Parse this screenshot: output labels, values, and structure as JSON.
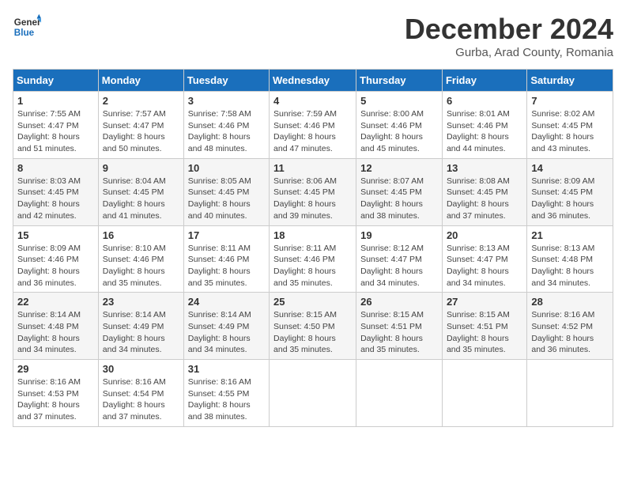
{
  "header": {
    "logo_general": "General",
    "logo_blue": "Blue",
    "month_title": "December 2024",
    "location": "Gurba, Arad County, Romania"
  },
  "days_of_week": [
    "Sunday",
    "Monday",
    "Tuesday",
    "Wednesday",
    "Thursday",
    "Friday",
    "Saturday"
  ],
  "weeks": [
    [
      {
        "day": "1",
        "sunrise": "Sunrise: 7:55 AM",
        "sunset": "Sunset: 4:47 PM",
        "daylight": "Daylight: 8 hours and 51 minutes."
      },
      {
        "day": "2",
        "sunrise": "Sunrise: 7:57 AM",
        "sunset": "Sunset: 4:47 PM",
        "daylight": "Daylight: 8 hours and 50 minutes."
      },
      {
        "day": "3",
        "sunrise": "Sunrise: 7:58 AM",
        "sunset": "Sunset: 4:46 PM",
        "daylight": "Daylight: 8 hours and 48 minutes."
      },
      {
        "day": "4",
        "sunrise": "Sunrise: 7:59 AM",
        "sunset": "Sunset: 4:46 PM",
        "daylight": "Daylight: 8 hours and 47 minutes."
      },
      {
        "day": "5",
        "sunrise": "Sunrise: 8:00 AM",
        "sunset": "Sunset: 4:46 PM",
        "daylight": "Daylight: 8 hours and 45 minutes."
      },
      {
        "day": "6",
        "sunrise": "Sunrise: 8:01 AM",
        "sunset": "Sunset: 4:46 PM",
        "daylight": "Daylight: 8 hours and 44 minutes."
      },
      {
        "day": "7",
        "sunrise": "Sunrise: 8:02 AM",
        "sunset": "Sunset: 4:45 PM",
        "daylight": "Daylight: 8 hours and 43 minutes."
      }
    ],
    [
      {
        "day": "8",
        "sunrise": "Sunrise: 8:03 AM",
        "sunset": "Sunset: 4:45 PM",
        "daylight": "Daylight: 8 hours and 42 minutes."
      },
      {
        "day": "9",
        "sunrise": "Sunrise: 8:04 AM",
        "sunset": "Sunset: 4:45 PM",
        "daylight": "Daylight: 8 hours and 41 minutes."
      },
      {
        "day": "10",
        "sunrise": "Sunrise: 8:05 AM",
        "sunset": "Sunset: 4:45 PM",
        "daylight": "Daylight: 8 hours and 40 minutes."
      },
      {
        "day": "11",
        "sunrise": "Sunrise: 8:06 AM",
        "sunset": "Sunset: 4:45 PM",
        "daylight": "Daylight: 8 hours and 39 minutes."
      },
      {
        "day": "12",
        "sunrise": "Sunrise: 8:07 AM",
        "sunset": "Sunset: 4:45 PM",
        "daylight": "Daylight: 8 hours and 38 minutes."
      },
      {
        "day": "13",
        "sunrise": "Sunrise: 8:08 AM",
        "sunset": "Sunset: 4:45 PM",
        "daylight": "Daylight: 8 hours and 37 minutes."
      },
      {
        "day": "14",
        "sunrise": "Sunrise: 8:09 AM",
        "sunset": "Sunset: 4:45 PM",
        "daylight": "Daylight: 8 hours and 36 minutes."
      }
    ],
    [
      {
        "day": "15",
        "sunrise": "Sunrise: 8:09 AM",
        "sunset": "Sunset: 4:46 PM",
        "daylight": "Daylight: 8 hours and 36 minutes."
      },
      {
        "day": "16",
        "sunrise": "Sunrise: 8:10 AM",
        "sunset": "Sunset: 4:46 PM",
        "daylight": "Daylight: 8 hours and 35 minutes."
      },
      {
        "day": "17",
        "sunrise": "Sunrise: 8:11 AM",
        "sunset": "Sunset: 4:46 PM",
        "daylight": "Daylight: 8 hours and 35 minutes."
      },
      {
        "day": "18",
        "sunrise": "Sunrise: 8:11 AM",
        "sunset": "Sunset: 4:46 PM",
        "daylight": "Daylight: 8 hours and 35 minutes."
      },
      {
        "day": "19",
        "sunrise": "Sunrise: 8:12 AM",
        "sunset": "Sunset: 4:47 PM",
        "daylight": "Daylight: 8 hours and 34 minutes."
      },
      {
        "day": "20",
        "sunrise": "Sunrise: 8:13 AM",
        "sunset": "Sunset: 4:47 PM",
        "daylight": "Daylight: 8 hours and 34 minutes."
      },
      {
        "day": "21",
        "sunrise": "Sunrise: 8:13 AM",
        "sunset": "Sunset: 4:48 PM",
        "daylight": "Daylight: 8 hours and 34 minutes."
      }
    ],
    [
      {
        "day": "22",
        "sunrise": "Sunrise: 8:14 AM",
        "sunset": "Sunset: 4:48 PM",
        "daylight": "Daylight: 8 hours and 34 minutes."
      },
      {
        "day": "23",
        "sunrise": "Sunrise: 8:14 AM",
        "sunset": "Sunset: 4:49 PM",
        "daylight": "Daylight: 8 hours and 34 minutes."
      },
      {
        "day": "24",
        "sunrise": "Sunrise: 8:14 AM",
        "sunset": "Sunset: 4:49 PM",
        "daylight": "Daylight: 8 hours and 34 minutes."
      },
      {
        "day": "25",
        "sunrise": "Sunrise: 8:15 AM",
        "sunset": "Sunset: 4:50 PM",
        "daylight": "Daylight: 8 hours and 35 minutes."
      },
      {
        "day": "26",
        "sunrise": "Sunrise: 8:15 AM",
        "sunset": "Sunset: 4:51 PM",
        "daylight": "Daylight: 8 hours and 35 minutes."
      },
      {
        "day": "27",
        "sunrise": "Sunrise: 8:15 AM",
        "sunset": "Sunset: 4:51 PM",
        "daylight": "Daylight: 8 hours and 35 minutes."
      },
      {
        "day": "28",
        "sunrise": "Sunrise: 8:16 AM",
        "sunset": "Sunset: 4:52 PM",
        "daylight": "Daylight: 8 hours and 36 minutes."
      }
    ],
    [
      {
        "day": "29",
        "sunrise": "Sunrise: 8:16 AM",
        "sunset": "Sunset: 4:53 PM",
        "daylight": "Daylight: 8 hours and 37 minutes."
      },
      {
        "day": "30",
        "sunrise": "Sunrise: 8:16 AM",
        "sunset": "Sunset: 4:54 PM",
        "daylight": "Daylight: 8 hours and 37 minutes."
      },
      {
        "day": "31",
        "sunrise": "Sunrise: 8:16 AM",
        "sunset": "Sunset: 4:55 PM",
        "daylight": "Daylight: 8 hours and 38 minutes."
      },
      null,
      null,
      null,
      null
    ]
  ]
}
